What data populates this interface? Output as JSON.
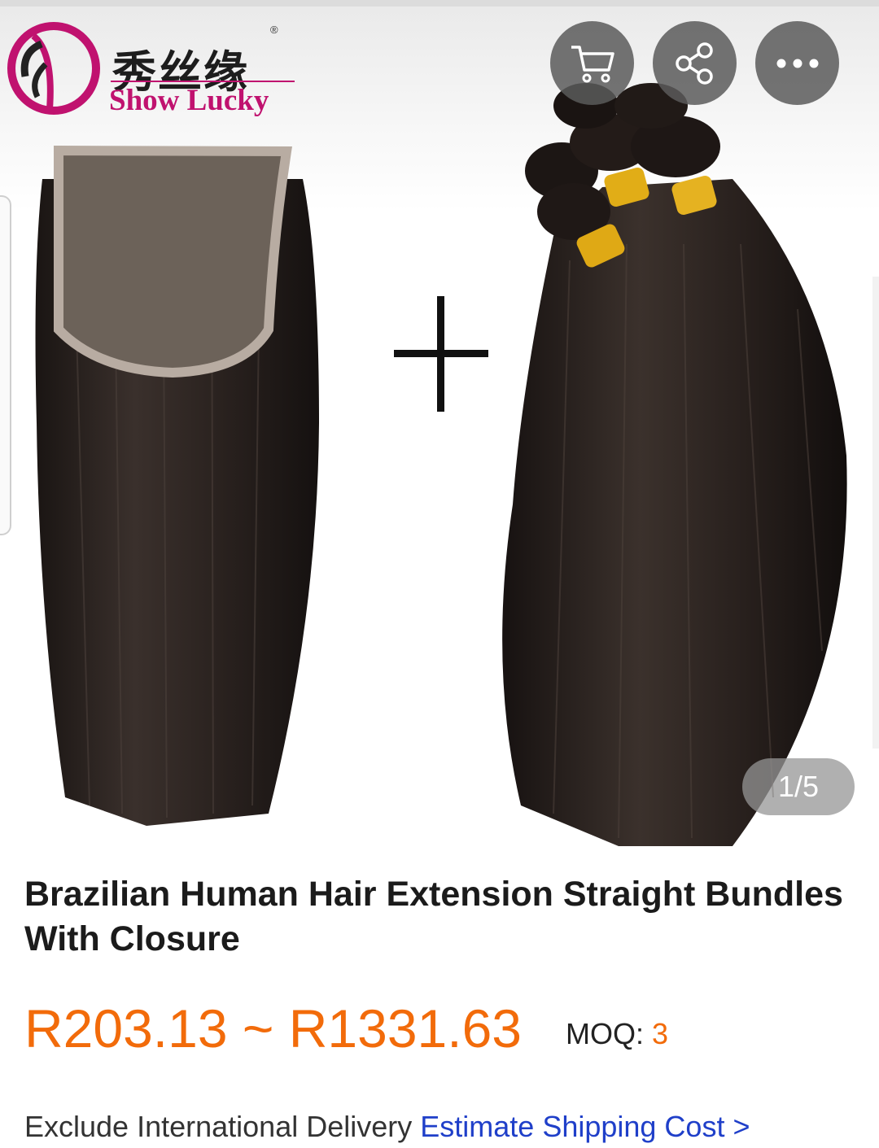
{
  "product_image": {
    "brand_cn": "秀丝缘",
    "brand_en": "Show Lucky",
    "registered_mark": "®",
    "counter": "1/5"
  },
  "actions": {
    "cart_icon": "cart-icon",
    "share_icon": "share-icon",
    "more_icon": "more-icon"
  },
  "product": {
    "title": "Brazilian Human Hair Extension Straight Bundles With Closure",
    "price_range": "R203.13 ~ R1331.63",
    "moq_label": "MOQ:",
    "moq_value": "3"
  },
  "shipping": {
    "note": "Exclude International Delivery",
    "link": "Estimate Shipping Cost >"
  },
  "colors": {
    "price": "#f26b0a",
    "link": "#1f3fc9",
    "brand": "#c0126f"
  }
}
